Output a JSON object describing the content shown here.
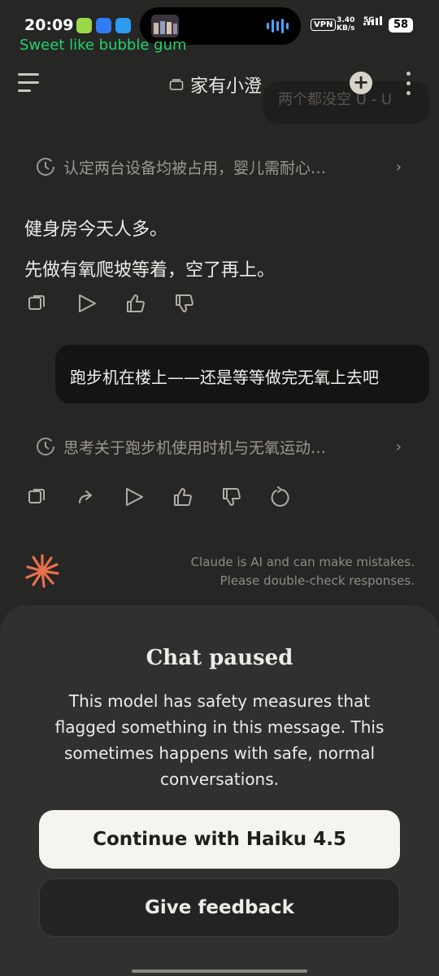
{
  "status_bar": {
    "time": "20:09",
    "vpn": "VPN",
    "net_speed_value": "3.40",
    "net_speed_unit": "KB/s",
    "network": "5G",
    "battery": "58",
    "lyric": "Sweet like bubble gum"
  },
  "header": {
    "title": "家有小澄",
    "peek_text": "两个都没空 U - U"
  },
  "conversation": {
    "thinking_1": "认定两台设备均被占用，婴儿需耐心…",
    "reply_line_1": "健身房今天人多。",
    "reply_line_2": "先做有氧爬坡等着，空了再上。",
    "user_message": "跑步机在楼上——还是等等做完无氧上去吧",
    "thinking_2": "思考关于跑步机使用时机与无氧运动…",
    "disclaimer_line_1": "Claude is AI and can make mistakes.",
    "disclaimer_line_2": "Please double-check responses."
  },
  "sheet": {
    "title": "Chat paused",
    "body": "This model has safety measures that flagged something in this message. This sometimes happens with safe, normal conversations.",
    "primary_button": "Continue with Haiku 4.5",
    "secondary_button": "Give feedback"
  },
  "colors": {
    "background": "#262624",
    "sheet": "#30302e",
    "lyric_green": "#22d36a",
    "claude_orange": "#e8704f",
    "primary_button": "#f5f4ee"
  }
}
